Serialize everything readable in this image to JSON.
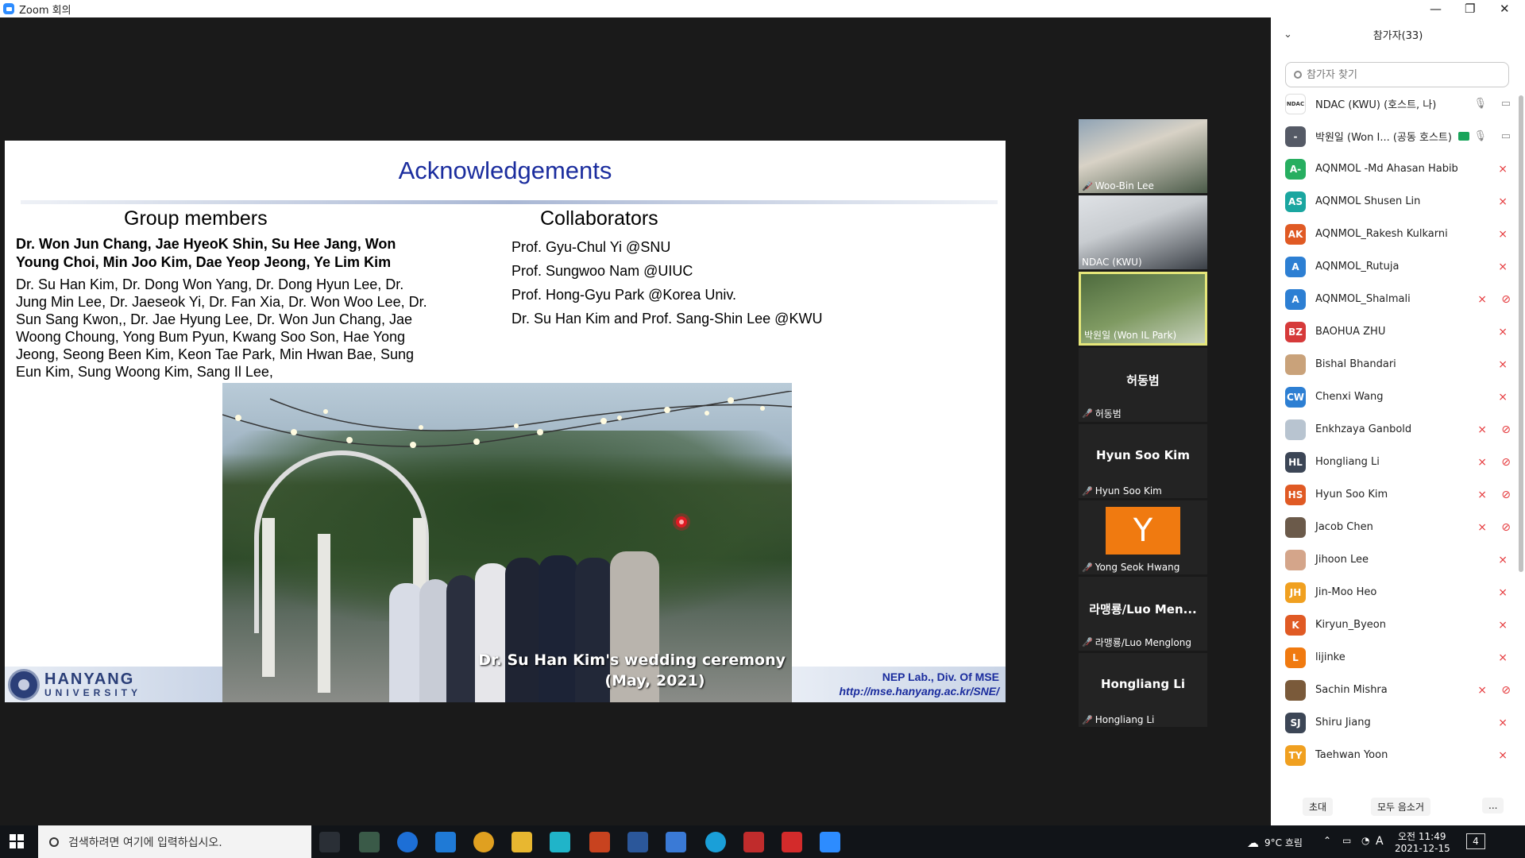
{
  "window": {
    "title": "Zoom 회의"
  },
  "slide": {
    "title": "Acknowledgements",
    "group_heading": "Group members",
    "collab_heading": "Collaborators",
    "bold_names": "Dr. Won Jun Chang, Jae HyeoK Shin, Su Hee Jang, Won Young Choi, Min Joo Kim, Dae Yeop Jeong, Ye Lim Kim",
    "names": "Dr. Su Han Kim, Dr. Dong Won Yang, Dr. Dong Hyun Lee, Dr. Jung Min Lee, Dr. Jaeseok Yi, Dr. Fan Xia, Dr. Won Woo Lee, Dr. Sun Sang Kwon,, Dr. Jae Hyung Lee, Dr. Won Jun Chang, Jae Woong Choung, Yong Bum Pyun, Kwang Soo Son, Hae Yong Jeong, Seong Been Kim, Keon Tae Park, Min Hwan Bae, Sung Eun Kim, Sung Woong Kim, Sang Il Lee,",
    "collaborators": [
      "Prof. Gyu-Chul Yi @SNU",
      "Prof. Sungwoo Nam @UIUC",
      "Prof. Hong-Gyu Park @Korea Univ.",
      "Dr. Su Han Kim and Prof. Sang-Shin Lee @KWU"
    ],
    "photo_caption_1": "Dr. Su Han Kim's wedding ceremony",
    "photo_caption_2": "(May, 2021)",
    "univ_line1": "HANYANG",
    "univ_line2": "UNIVERSITY",
    "lab_line1": "NEP Lab., Div. Of MSE",
    "lab_line2": "http://mse.hanyang.ac.kr/SNE/"
  },
  "thumbnails": [
    {
      "name": "Woo-Bin Lee",
      "muted": true,
      "video": true
    },
    {
      "name": "NDAC (KWU)",
      "muted": false,
      "video": true
    },
    {
      "name": "박원일 (Won IL Park)",
      "muted": false,
      "video": true,
      "active": true
    },
    {
      "name": "허동범",
      "big": "허동범",
      "muted": true
    },
    {
      "name": "Hyun Soo Kim",
      "big": "Hyun Soo Kim",
      "muted": true
    },
    {
      "name": "Yong Seok Hwang",
      "big": "Y",
      "muted": true
    },
    {
      "name": "라맹룡/Luo Menglong",
      "big": "라맹룡/Luo Men...",
      "muted": true
    },
    {
      "name": "Hongliang Li",
      "big": "Hongliang Li",
      "muted": true
    }
  ],
  "panel": {
    "header": "참가자(33)",
    "search_placeholder": "참가자 찾기",
    "participants": [
      {
        "initials": "NDAC",
        "color": "#ffffff",
        "name": "NDAC (KWU) (호스트, 나)",
        "mic": "on",
        "cam": "on"
      },
      {
        "initials": "-",
        "color": "#555a66",
        "name": "박원일 (Won I... (공동 호스트)",
        "mic": "on",
        "cam": "on",
        "badge": true
      },
      {
        "initials": "A-",
        "color": "#27ae60",
        "name": "AQNMOL -Md Ahasan Habib",
        "mic": "off"
      },
      {
        "initials": "AS",
        "color": "#1aa6a0",
        "name": "AQNMOL Shusen Lin",
        "mic": "off"
      },
      {
        "initials": "AK",
        "color": "#e05a24",
        "name": "AQNMOL_Rakesh Kulkarni",
        "mic": "off"
      },
      {
        "initials": "A",
        "color": "#2d7fd3",
        "name": "AQNMOL_Rutuja",
        "mic": "off"
      },
      {
        "initials": "A",
        "color": "#2d7fd3",
        "name": "AQNMOL_Shalmali",
        "mic": "off",
        "cam": "off"
      },
      {
        "initials": "BZ",
        "color": "#d63a3a",
        "name": "BAOHUA ZHU",
        "mic": "off"
      },
      {
        "initials": "",
        "color": "#c9a27a",
        "name": "Bishal Bhandari",
        "mic": "off"
      },
      {
        "initials": "CW",
        "color": "#2d7fd3",
        "name": "Chenxi Wang",
        "mic": "off"
      },
      {
        "initials": "",
        "color": "#b8c4d0",
        "name": "Enkhzaya Ganbold",
        "mic": "off",
        "cam": "off"
      },
      {
        "initials": "HL",
        "color": "#3c4656",
        "name": "Hongliang Li",
        "mic": "off",
        "cam": "off"
      },
      {
        "initials": "HS",
        "color": "#e05a24",
        "name": "Hyun Soo Kim",
        "mic": "off",
        "cam": "off"
      },
      {
        "initials": "",
        "color": "#6b5a4a",
        "name": "Jacob Chen",
        "mic": "off",
        "cam": "off"
      },
      {
        "initials": "",
        "color": "#d4a58a",
        "name": "Jihoon Lee",
        "mic": "off"
      },
      {
        "initials": "JH",
        "color": "#f0a020",
        "name": "Jin-Moo Heo",
        "mic": "off"
      },
      {
        "initials": "K",
        "color": "#e05a24",
        "name": "Kiryun_Byeon",
        "mic": "off"
      },
      {
        "initials": "L",
        "color": "#f07a10",
        "name": "lijinke",
        "mic": "off"
      },
      {
        "initials": "",
        "color": "#7a5a3a",
        "name": "Sachin Mishra",
        "mic": "off",
        "cam": "off"
      },
      {
        "initials": "SJ",
        "color": "#3c4656",
        "name": "Shiru Jiang",
        "mic": "off"
      },
      {
        "initials": "TY",
        "color": "#f0a020",
        "name": "Taehwan Yoon",
        "mic": "off"
      }
    ],
    "invite_label": "초대",
    "mute_all_label": "모두 음소거",
    "more_label": "..."
  },
  "taskbar": {
    "search_text": "검색하려면 여기에 입력하십시오.",
    "weather": "9°C 흐림",
    "ime": "A",
    "time": "오전 11:49",
    "date": "2021-12-15",
    "notifications": "4"
  },
  "icons": [
    "zoom-logo-icon",
    "search-icon",
    "mic-off-icon",
    "camera-off-icon",
    "mic-icon",
    "camera-icon",
    "windows-start-icon",
    "chevron-down-icon"
  ]
}
